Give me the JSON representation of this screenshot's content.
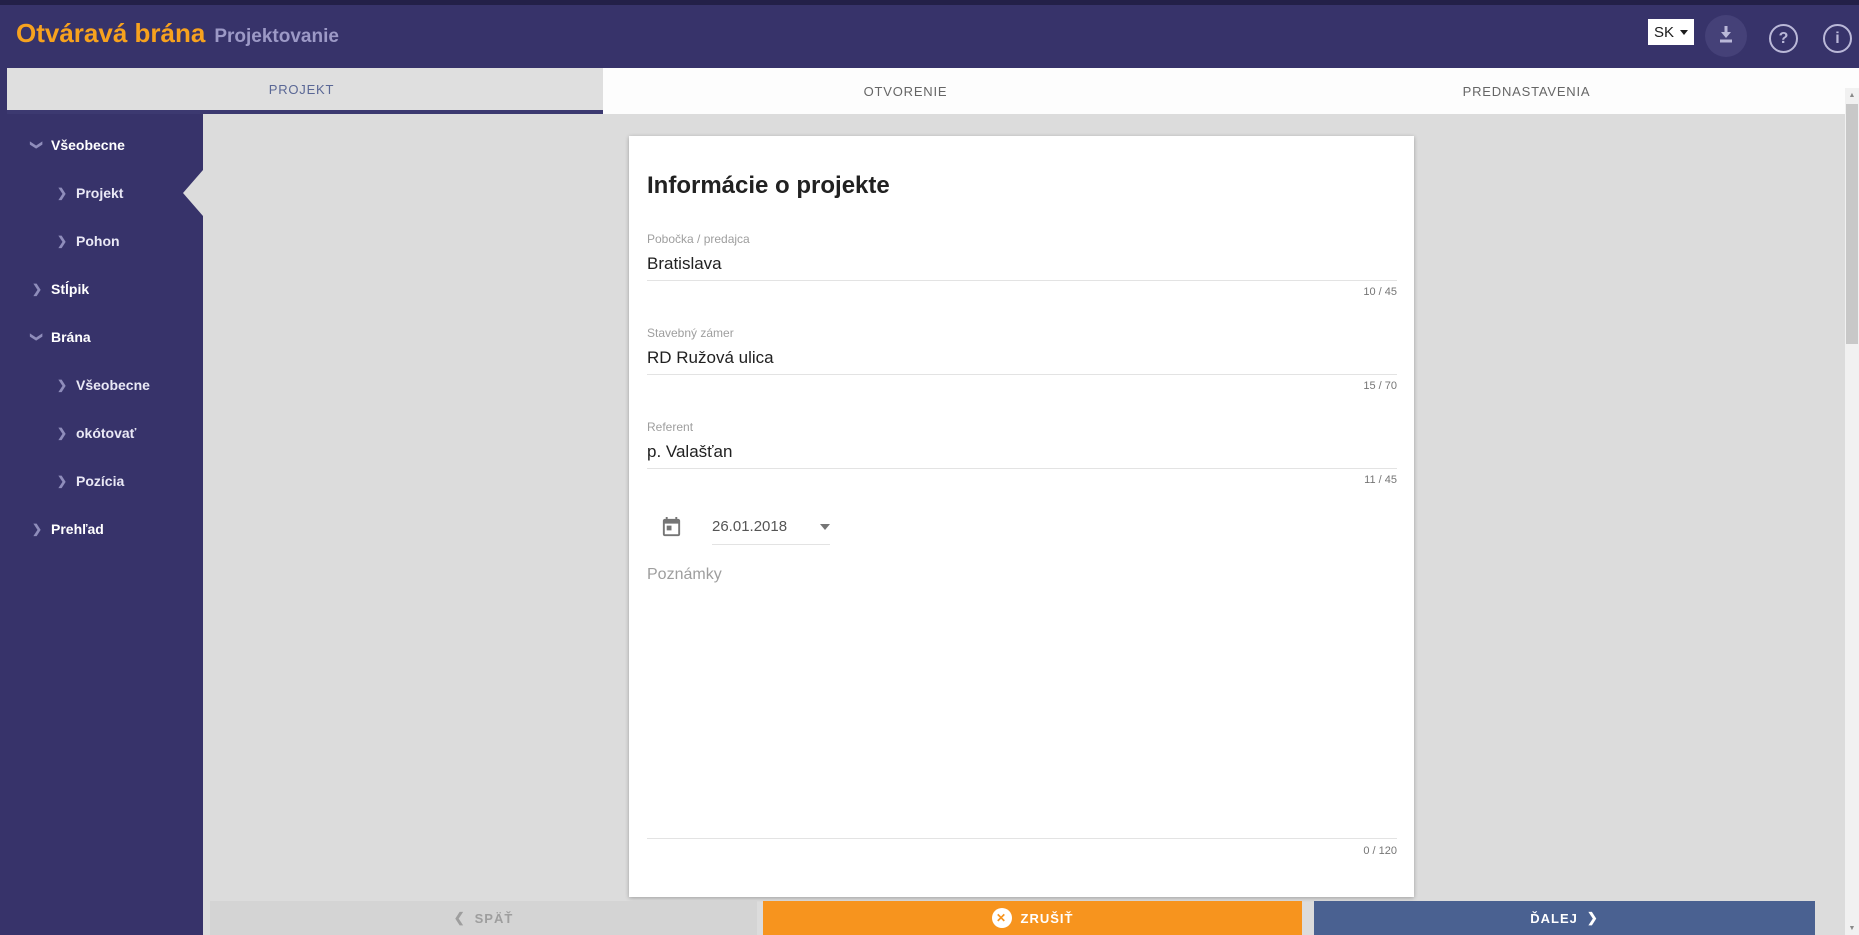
{
  "header": {
    "title": "Otváravá brána",
    "subtitle": "Projektovanie",
    "language": "SK",
    "help_icon": "?",
    "info_icon": "i"
  },
  "tabs": [
    {
      "label": "PROJEKT",
      "active": true
    },
    {
      "label": "OTVORENIE",
      "active": false
    },
    {
      "label": "PREDNASTAVENIA",
      "active": false
    }
  ],
  "sidebar": {
    "items": [
      {
        "label": "Všeobecne",
        "level": 1,
        "state": "expanded",
        "active": false
      },
      {
        "label": "Projekt",
        "level": 2,
        "state": "leaf",
        "active": true
      },
      {
        "label": "Pohon",
        "level": 2,
        "state": "leaf",
        "active": false
      },
      {
        "label": "Stĺpik",
        "level": 1,
        "state": "collapsed",
        "active": false
      },
      {
        "label": "Brána",
        "level": 1,
        "state": "expanded",
        "active": false
      },
      {
        "label": "Všeobecne",
        "level": 2,
        "state": "leaf",
        "active": false
      },
      {
        "label": "okótovať",
        "level": 2,
        "state": "leaf",
        "active": false
      },
      {
        "label": "Pozícia",
        "level": 2,
        "state": "leaf",
        "active": false
      },
      {
        "label": "Prehľad",
        "level": 1,
        "state": "collapsed",
        "active": false
      }
    ]
  },
  "form": {
    "title": "Informácie o projekte",
    "fields": [
      {
        "label": "Pobočka / predajca",
        "value": "Bratislava",
        "counter": "10 / 45"
      },
      {
        "label": "Stavebný zámer",
        "value": "RD Ružová ulica",
        "counter": "15 / 70"
      },
      {
        "label": "Referent",
        "value": "p. Valašťan",
        "counter": "11 / 45"
      }
    ],
    "date": {
      "value": "26.01.2018"
    },
    "notes": {
      "placeholder": "Poznámky",
      "counter": "0 / 120"
    }
  },
  "footer": {
    "back_label": "SPÄŤ",
    "cancel_label": "ZRUŠIŤ",
    "cancel_icon": "✕",
    "next_label": "ĎALEJ"
  },
  "colors": {
    "header_bg": "#37336A",
    "brand_orange": "#F7A21E",
    "cancel_orange": "#F7941E",
    "next_blue": "#4A6191",
    "active_tab_bg": "#DFDFDF",
    "content_bg": "#DCDCDC"
  }
}
